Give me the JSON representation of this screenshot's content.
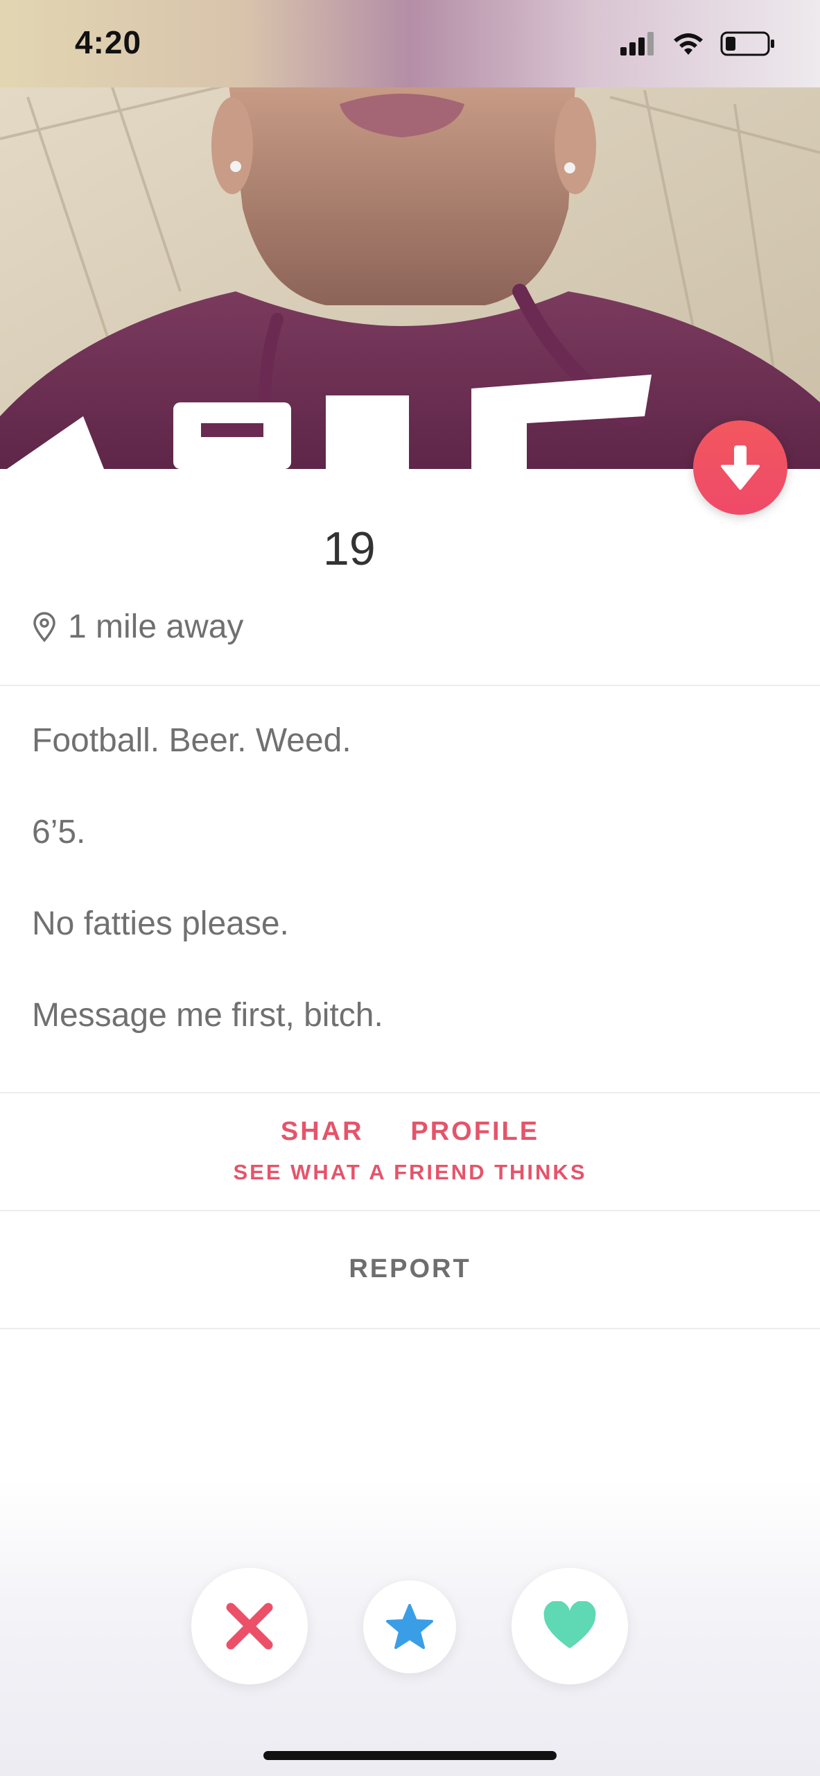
{
  "status_bar": {
    "time": "4:20"
  },
  "profile": {
    "age": "19",
    "distance": "1 mile away"
  },
  "bio": [
    "Football. Beer. Weed.",
    "6’5.",
    "No fatties please.",
    "Message me first, bitch."
  ],
  "share": {
    "title": "SHAR     PROFILE",
    "subtitle": "SEE WHAT A FRIEND THINKS"
  },
  "report": {
    "label": "REPORT"
  },
  "actions": {
    "nope_icon": "close-icon",
    "superlike_icon": "star-icon",
    "like_icon": "heart-icon"
  },
  "colors": {
    "accent": "#e5546a",
    "download_button": "#ef4a69",
    "nope": "#ec5068",
    "superlike": "#3a9ee6",
    "like": "#5fd8b4"
  }
}
